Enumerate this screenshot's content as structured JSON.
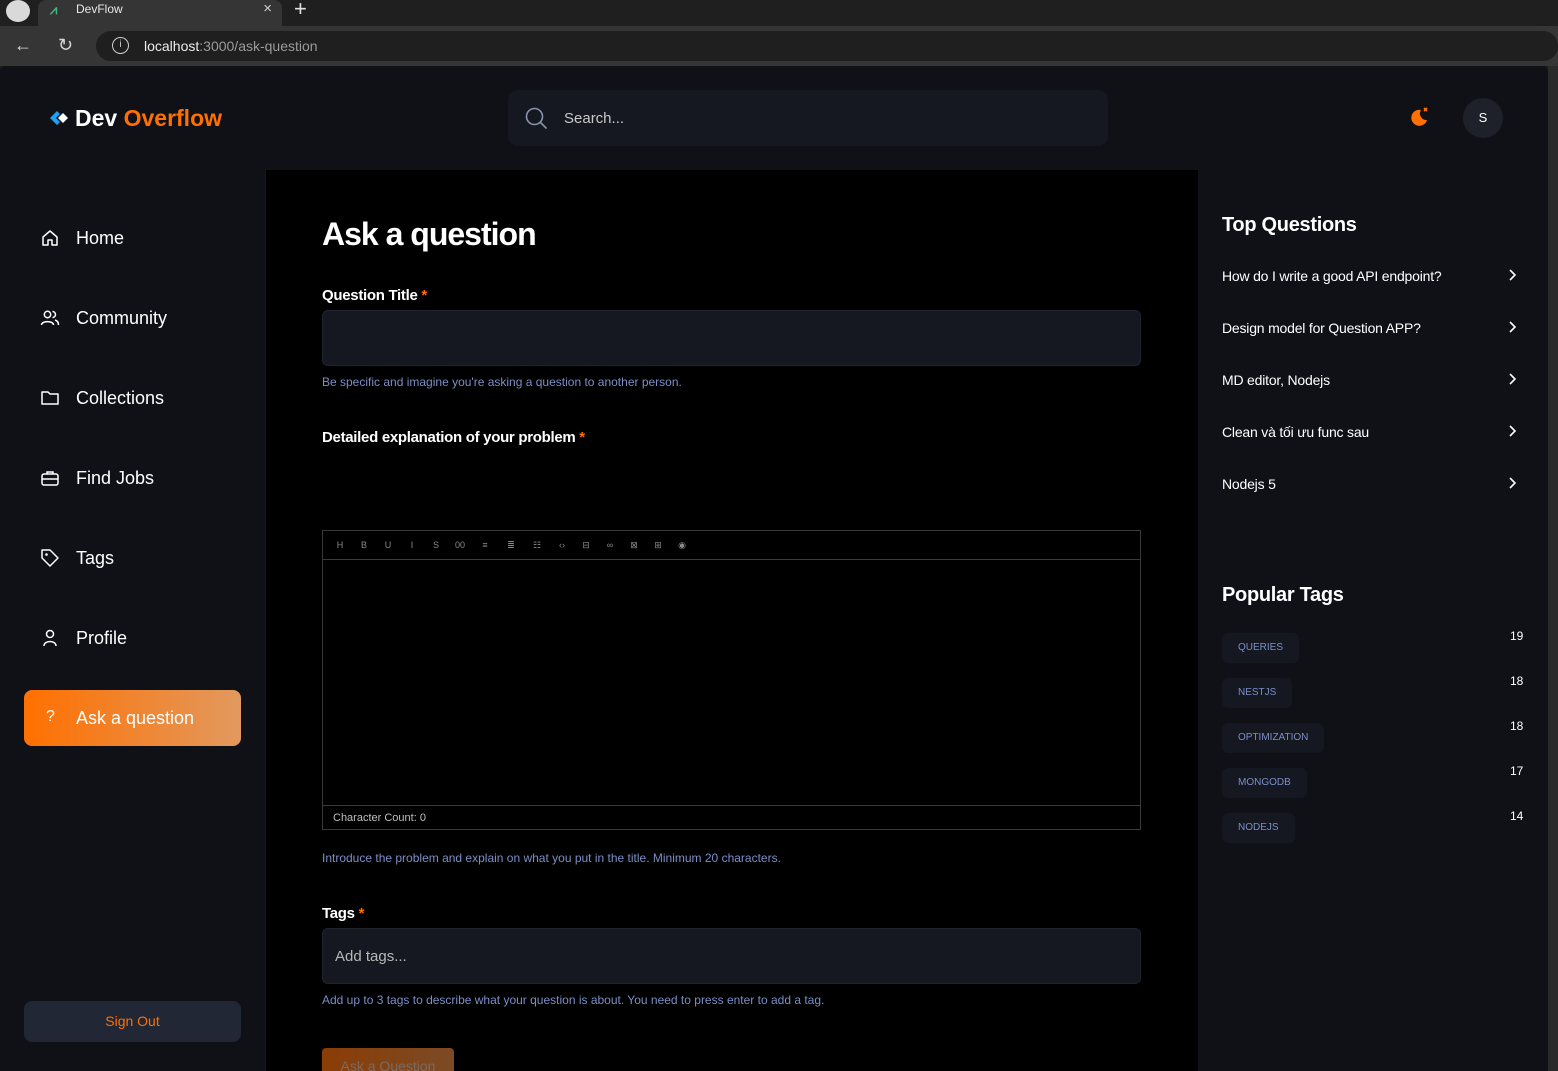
{
  "browser": {
    "tab_title": "DevFlow",
    "tab_close": "×",
    "new_tab": "+",
    "url_host": "localhost",
    "url_path": ":3000/ask-question"
  },
  "header": {
    "logo_dev": "Dev",
    "logo_overflow": "Overflow",
    "search_placeholder": "Search...",
    "avatar_initial": "S"
  },
  "sidebar": {
    "items": [
      {
        "label": "Home",
        "icon": "home-icon"
      },
      {
        "label": "Community",
        "icon": "users-icon"
      },
      {
        "label": "Collections",
        "icon": "folder-icon"
      },
      {
        "label": "Find Jobs",
        "icon": "briefcase-icon"
      },
      {
        "label": "Tags",
        "icon": "tag-icon"
      },
      {
        "label": "Profile",
        "icon": "user-icon"
      },
      {
        "label": "Ask a question",
        "icon": "question-icon",
        "active": true
      }
    ],
    "active_icon_glyph": "?",
    "sign_out": "Sign Out"
  },
  "form": {
    "page_title": "Ask a question",
    "title_label": "Question Title",
    "required_mark": "*",
    "title_value": "",
    "title_hint": "Be specific and imagine you're asking a question to another person.",
    "explanation_label": "Detailed explanation of your problem",
    "editor_toolbar": [
      "H",
      "B",
      "U",
      "I",
      "S",
      "00",
      "≡",
      "≣",
      "☷",
      "‹›",
      "⊟",
      "∞",
      "⊠",
      "⊞",
      "◉"
    ],
    "character_count_label": "Character Count:",
    "character_count": "0",
    "explanation_hint": "Introduce the problem and explain on what you put in the title. Minimum 20 characters.",
    "tags_label": "Tags",
    "tags_placeholder": "Add tags...",
    "tags_hint": "Add up to 3 tags to describe what your question is about. You need to press enter to add a tag.",
    "submit": "Ask a Question"
  },
  "right_sidebar": {
    "top_questions_title": "Top Questions",
    "top_questions": [
      "How do I write a good API endpoint?",
      "Design model for Question APP?",
      "MD editor, Nodejs",
      "Clean và tối ưu func sau",
      "Nodejs 5"
    ],
    "popular_tags_title": "Popular Tags",
    "popular_tags": [
      {
        "name": "QUERIES",
        "count": "19"
      },
      {
        "name": "NESTJS",
        "count": "18"
      },
      {
        "name": "OPTIMIZATION",
        "count": "18"
      },
      {
        "name": "MONGODB",
        "count": "17"
      },
      {
        "name": "NODEJS",
        "count": "14"
      }
    ]
  },
  "colors": {
    "accent": "#ff7000",
    "background": "#0f1117",
    "main_bg": "#000000",
    "hint": "#7b8ec8"
  }
}
